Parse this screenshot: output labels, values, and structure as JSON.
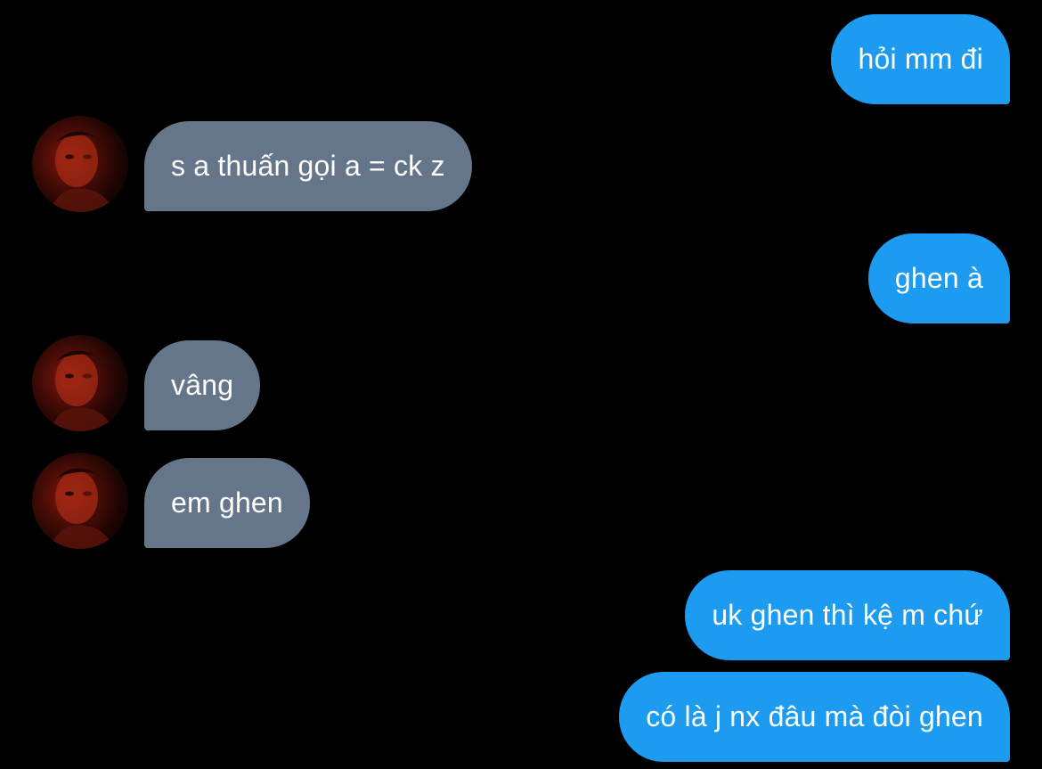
{
  "conversation": {
    "messages": [
      {
        "side": "sent",
        "text": "hỏi mm đi"
      },
      {
        "side": "received",
        "text": "s a thuấn gọi a = ck z"
      },
      {
        "side": "sent",
        "text": "ghen à"
      },
      {
        "side": "received",
        "text": "vâng"
      },
      {
        "side": "received",
        "text": "em ghen"
      },
      {
        "side": "sent",
        "text": "uk ghen thì kệ m chứ"
      },
      {
        "side": "sent",
        "text": "có là j nx đâu mà đòi ghen"
      }
    ]
  },
  "colors": {
    "background": "#000000",
    "sent_bubble": "#1d9bf0",
    "received_bubble": "#66768a",
    "text": "#ffffff"
  },
  "icons": {
    "avatar": "contact-avatar-photo"
  }
}
